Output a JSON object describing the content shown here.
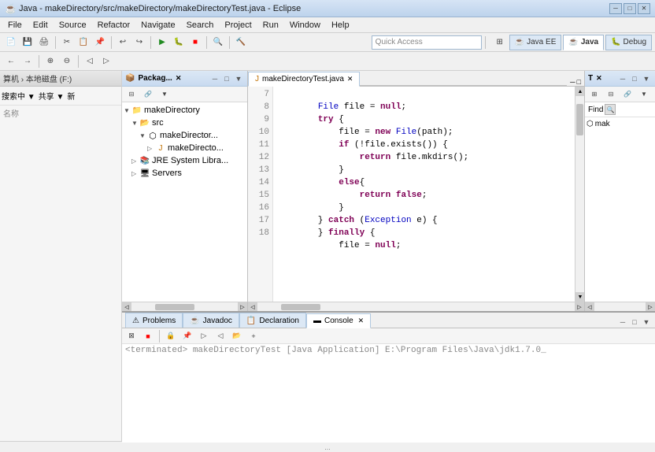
{
  "titleBar": {
    "text": "Java - makeDirectory/src/makeDirectory/makeDirectoryTest.java - Eclipse",
    "icon": "☕",
    "minimize": "─",
    "maximize": "□",
    "close": "✕"
  },
  "menuBar": {
    "items": [
      "File",
      "Edit",
      "Source",
      "Refactor",
      "Navigate",
      "Search",
      "Project",
      "Run",
      "Window",
      "Help"
    ]
  },
  "toolbar": {
    "quickAccess": "Quick Access",
    "perspectives": [
      "Java EE",
      "Java",
      "Debug"
    ]
  },
  "packageExplorer": {
    "title": "Packag...",
    "tree": [
      {
        "label": "makeDirectory",
        "indent": 0,
        "arrow": "▼",
        "icon": "📁"
      },
      {
        "label": "src",
        "indent": 1,
        "arrow": "▼",
        "icon": "📂"
      },
      {
        "label": "makeDirector...",
        "indent": 2,
        "arrow": "▼",
        "icon": "📦"
      },
      {
        "label": "makeDirecto...",
        "indent": 3,
        "arrow": "▷",
        "icon": "☕"
      },
      {
        "label": "JRE System Libra...",
        "indent": 1,
        "arrow": "▷",
        "icon": "📚"
      },
      {
        "label": "Servers",
        "indent": 1,
        "arrow": "▷",
        "icon": "🖥"
      }
    ]
  },
  "editor": {
    "tabName": "makeDirectoryTest.java",
    "lines": [
      {
        "num": 7,
        "code": "        File file = null;"
      },
      {
        "num": 8,
        "code": "        try {"
      },
      {
        "num": 9,
        "code": "            file = new File(path);"
      },
      {
        "num": 10,
        "code": "            if (!file.exists()) {"
      },
      {
        "num": 11,
        "code": "                return file.mkdirs();"
      },
      {
        "num": 12,
        "code": "            }"
      },
      {
        "num": 13,
        "code": "            else{"
      },
      {
        "num": 14,
        "code": "                return false;"
      },
      {
        "num": 15,
        "code": "            }"
      },
      {
        "num": 16,
        "code": "        } catch (Exception e) {"
      },
      {
        "num": 17,
        "code": "        } finally {"
      },
      {
        "num": 18,
        "code": "            file = null;"
      }
    ]
  },
  "outlinePanel": {
    "title": "T",
    "findLabel": "Find"
  },
  "bottomPanel": {
    "tabs": [
      "Problems",
      "Javadoc",
      "Declaration",
      "Console"
    ],
    "activeTab": "Console",
    "consoleOutput": "<terminated> makeDirectoryTest [Java Application] E:\\Program Files\\Java\\jdk1.7.0_"
  },
  "statusBar": {
    "text": "..."
  }
}
